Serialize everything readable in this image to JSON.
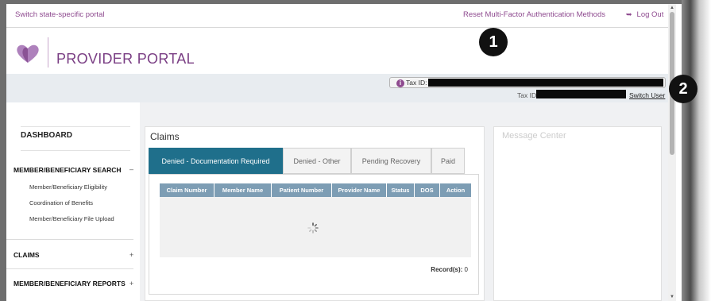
{
  "topbar": {
    "switch_portal": "Switch state-specific portal",
    "reset_mfa": "Reset Multi-Factor Authentication Methods",
    "logout": "Log Out"
  },
  "header": {
    "title": "PROVIDER PORTAL",
    "brand_color": "#8e4a8f"
  },
  "callouts": [
    "1",
    "2"
  ],
  "taxbar": {
    "tax_id_label": "Tax ID:",
    "tax_id_label_2": "Tax ID:",
    "switch_user": "Switch User"
  },
  "sidebar": {
    "dashboard": "DASHBOARD",
    "member_search": {
      "label": "MEMBER/BENEFICIARY SEARCH",
      "toggle": "–",
      "items": [
        "Member/Beneficiary Eligibility",
        "Coordination of Benefits",
        "Member/Beneficiary File Upload"
      ]
    },
    "claims": {
      "label": "CLAIMS",
      "toggle": "+"
    },
    "reports": {
      "label": "MEMBER/BENEFICIARY REPORTS",
      "toggle": "+"
    }
  },
  "claims": {
    "title": "Claims",
    "tabs": [
      "Denied - Documentation Required",
      "Denied - Other",
      "Pending Recovery",
      "Paid"
    ],
    "active_tab": 0,
    "active_tab_color": "#1f6f8b",
    "columns": [
      "Claim Number",
      "Member Name",
      "Patient Number",
      "Provider Name",
      "Status",
      "DOS",
      "Action"
    ],
    "header_color": "#7d9db4",
    "records_label": "Record(s):",
    "records_count": "0"
  },
  "right_panel": {
    "title": "Message Center"
  }
}
